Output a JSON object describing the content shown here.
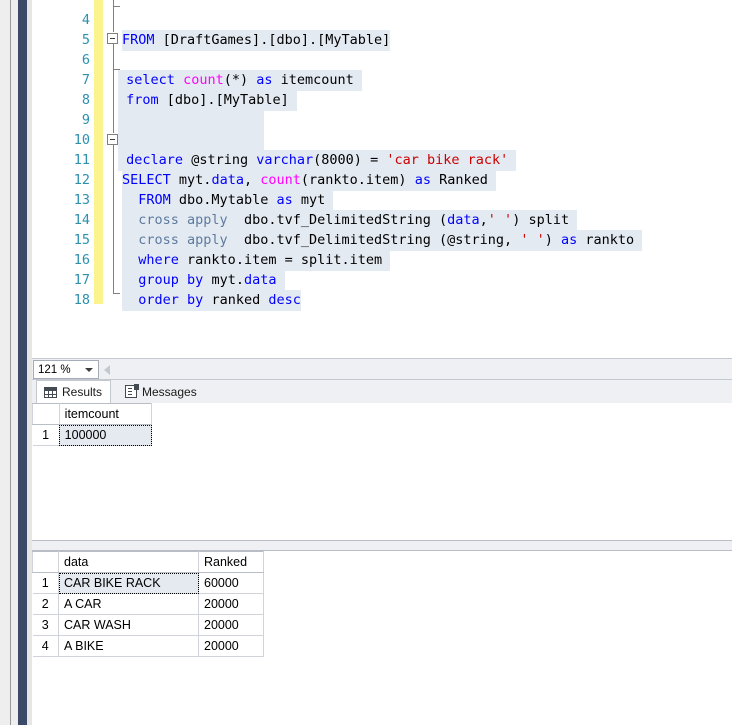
{
  "window": {
    "app": "SQL Server Management Studio",
    "accent_navy": "#3b4a66",
    "chrome_gray": "#eeeeee"
  },
  "editor": {
    "change_bar_color": "#fbf38d",
    "line_number_color": "#2b91af",
    "selection_color": "#e4eaf2",
    "lines": [
      {
        "num": "4",
        "text": "FROM [DraftGames].[dbo].[MyTable]"
      },
      {
        "num": "5",
        "text": ""
      },
      {
        "num": "6",
        "text": "select count(*) as itemcount"
      },
      {
        "num": "7",
        "text": "from [dbo].[MyTable]"
      },
      {
        "num": "8",
        "text": ""
      },
      {
        "num": "9",
        "text": ""
      },
      {
        "num": "10",
        "text": "declare @string varchar(8000) = 'car bike rack'"
      },
      {
        "num": "11",
        "text": "SELECT myt.data, count(rankto.item) as Ranked"
      },
      {
        "num": "12",
        "text": "FROM dbo.Mytable as myt"
      },
      {
        "num": "13",
        "text": "cross apply  dbo.tvf_DelimitedString (data,' ') split"
      },
      {
        "num": "14",
        "text": "cross apply  dbo.tvf_DelimitedString (@string, ' ') as rankto"
      },
      {
        "num": "15",
        "text": "where rankto.item = split.item"
      },
      {
        "num": "16",
        "text": "group by myt.data"
      },
      {
        "num": "17",
        "text": "order by ranked desc"
      },
      {
        "num": "18",
        "text": ""
      }
    ]
  },
  "zoom_control": {
    "value": "121 %",
    "caret": "chevron-down-icon"
  },
  "tabs": [
    {
      "label": "Results",
      "icon": "grid-icon",
      "active": true
    },
    {
      "label": "Messages",
      "icon": "document-icon",
      "active": false
    }
  ],
  "results_grid_1": {
    "columns": [
      "itemcount"
    ],
    "rows": [
      {
        "num": "1",
        "cells": [
          "100000"
        ]
      }
    ],
    "focused_cell": {
      "row": 0,
      "col": 0
    }
  },
  "results_grid_2": {
    "columns": [
      "data",
      "Ranked"
    ],
    "rows": [
      {
        "num": "1",
        "cells": [
          "CAR BIKE RACK",
          "60000"
        ]
      },
      {
        "num": "2",
        "cells": [
          "A CAR",
          "20000"
        ]
      },
      {
        "num": "3",
        "cells": [
          "CAR WASH",
          "20000"
        ]
      },
      {
        "num": "4",
        "cells": [
          "A BIKE",
          "20000"
        ]
      }
    ],
    "focused_cell": {
      "row": 0,
      "col": 0
    }
  }
}
